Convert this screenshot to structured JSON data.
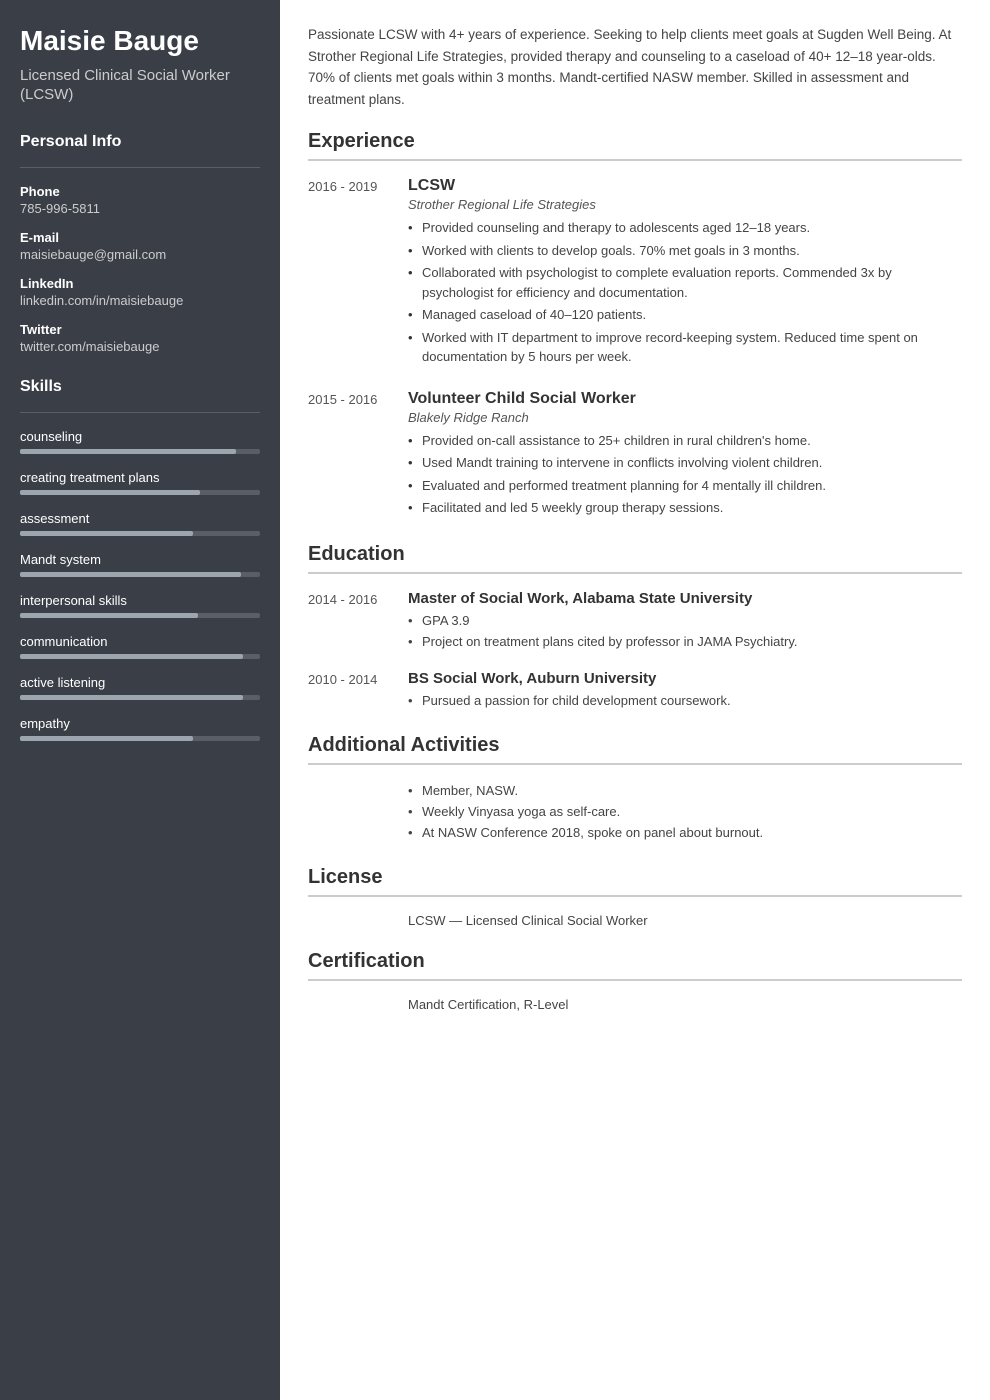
{
  "sidebar": {
    "name": "Maisie Bauge",
    "title": "Licensed Clinical Social Worker (LCSW)",
    "personal_info_label": "Personal Info",
    "contacts": [
      {
        "label": "Phone",
        "value": "785-996-5811"
      },
      {
        "label": "E-mail",
        "value": "maisiebauge@gmail.com"
      },
      {
        "label": "LinkedIn",
        "value": "linkedin.com/in/maisiebauge"
      },
      {
        "label": "Twitter",
        "value": "twitter.com/maisiebauge"
      }
    ],
    "skills_label": "Skills",
    "skills": [
      {
        "name": "counseling",
        "percent": 90
      },
      {
        "name": "creating treatment plans",
        "percent": 75
      },
      {
        "name": "assessment",
        "percent": 72
      },
      {
        "name": "Mandt system",
        "percent": 92
      },
      {
        "name": "interpersonal skills",
        "percent": 74
      },
      {
        "name": "communication",
        "percent": 93
      },
      {
        "name": "active listening",
        "percent": 93
      },
      {
        "name": "empathy",
        "percent": 72
      }
    ]
  },
  "main": {
    "summary": "Passionate LCSW with 4+ years of experience. Seeking to help clients meet goals at Sugden Well Being. At Strother Regional Life Strategies, provided therapy and counseling to a caseload of 40+ 12–18 year-olds. 70% of clients met goals within 3 months. Mandt-certified NASW member. Skilled in assessment and treatment plans.",
    "experience_label": "Experience",
    "experiences": [
      {
        "dates": "2016 - 2019",
        "title": "LCSW",
        "company": "Strother Regional Life Strategies",
        "bullets": [
          "Provided counseling and therapy to adolescents aged 12–18 years.",
          "Worked with clients to develop goals. 70% met goals in 3 months.",
          "Collaborated with psychologist to complete evaluation reports. Commended 3x by psychologist for efficiency and documentation.",
          "Managed caseload of 40–120 patients.",
          "Worked with IT department to improve record-keeping system. Reduced time spent on documentation by 5 hours per week."
        ]
      },
      {
        "dates": "2015 - 2016",
        "title": "Volunteer Child Social Worker",
        "company": "Blakely Ridge Ranch",
        "bullets": [
          "Provided on-call assistance to 25+ children in rural children's home.",
          "Used Mandt training to intervene in conflicts involving violent children.",
          "Evaluated and performed treatment planning for 4 mentally ill children.",
          "Facilitated and led 5 weekly group therapy sessions."
        ]
      }
    ],
    "education_label": "Education",
    "educations": [
      {
        "dates": "2014 - 2016",
        "title": "Master of Social Work, Alabama State University",
        "bullets": [
          "GPA 3.9",
          "Project on treatment plans cited by professor in JAMA Psychiatry."
        ]
      },
      {
        "dates": "2010 - 2014",
        "title": "BS Social Work, Auburn University",
        "bullets": [
          "Pursued a passion for child development coursework."
        ]
      }
    ],
    "activities_label": "Additional Activities",
    "activities": [
      "Member, NASW.",
      "Weekly Vinyasa yoga as self-care.",
      "At NASW Conference 2018, spoke on panel about burnout."
    ],
    "license_label": "License",
    "license_text": "LCSW — Licensed Clinical Social Worker",
    "certification_label": "Certification",
    "certification_text": "Mandt Certification, R-Level"
  }
}
